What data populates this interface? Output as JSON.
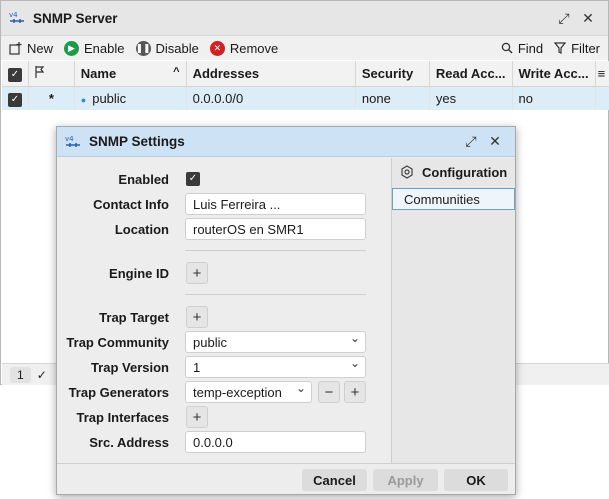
{
  "window": {
    "title": "SNMP Server"
  },
  "toolbar": {
    "new": "New",
    "enable": "Enable",
    "disable": "Disable",
    "remove": "Remove",
    "find": "Find",
    "filter": "Filter"
  },
  "table": {
    "headers": [
      "Name",
      "Addresses",
      "Security",
      "Read Acc...",
      "Write Acc..."
    ],
    "rows": [
      {
        "flag": "*",
        "name": "public",
        "addresses": "0.0.0.0/0",
        "security": "none",
        "read": "yes",
        "write": "no"
      }
    ]
  },
  "status": {
    "count": "1"
  },
  "dialog": {
    "title": "SNMP Settings",
    "labels": {
      "enabled": "Enabled",
      "contact": "Contact Info",
      "location": "Location",
      "engine": "Engine ID",
      "trap_target": "Trap Target",
      "trap_community": "Trap Community",
      "trap_version": "Trap Version",
      "trap_generators": "Trap Generators",
      "trap_interfaces": "Trap Interfaces",
      "src_address": "Src. Address"
    },
    "values": {
      "contact": "Luis Ferreira ...",
      "location": "routerOS en SMR1",
      "trap_community": "public",
      "trap_version": "1",
      "trap_generators": "temp-exception",
      "src_address": "0.0.0.0"
    },
    "side": {
      "header": "Configuration",
      "item": "Communities"
    },
    "buttons": {
      "cancel": "Cancel",
      "apply": "Apply",
      "ok": "OK"
    }
  }
}
